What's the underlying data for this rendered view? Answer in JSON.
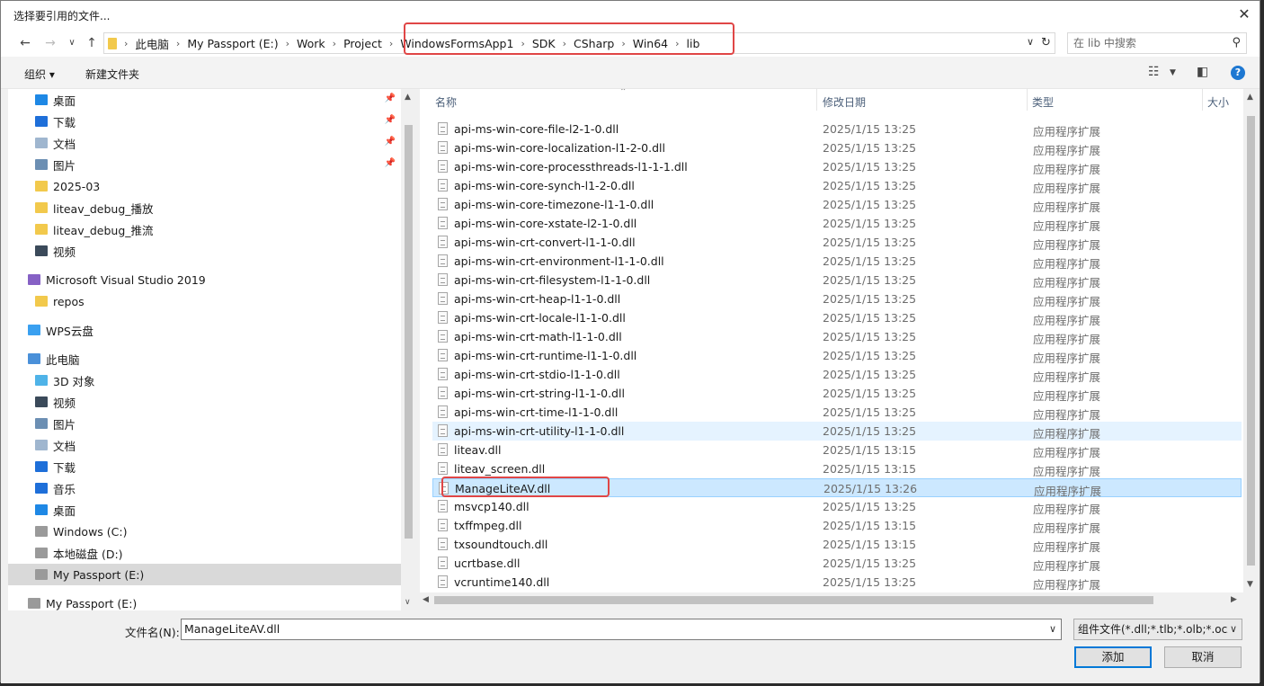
{
  "window": {
    "title": "选择要引用的文件..."
  },
  "address": {
    "crumbs": [
      "此电脑",
      "My Passport (E:)",
      "Work",
      "Project",
      "WindowsFormsApp1",
      "SDK",
      "CSharp",
      "Win64",
      "lib"
    ],
    "search_placeholder": "在 lib 中搜索"
  },
  "toolbar": {
    "organize": "组织 ▾",
    "new_folder": "新建文件夹"
  },
  "nav": {
    "items": [
      {
        "label": "桌面",
        "icon": "desktop-icon",
        "color": "#1e88e5",
        "pinned": true
      },
      {
        "label": "下载",
        "icon": "download-icon",
        "color": "#1e6fd9",
        "pinned": true
      },
      {
        "label": "文档",
        "icon": "documents-icon",
        "color": "#9fb6cf",
        "pinned": true
      },
      {
        "label": "图片",
        "icon": "pictures-icon",
        "color": "#6c8fb3",
        "pinned": true
      },
      {
        "label": "2025-03",
        "icon": "folder-icon",
        "color": "#f2c94c"
      },
      {
        "label": "liteav_debug_播放",
        "icon": "folder-icon",
        "color": "#f2c94c"
      },
      {
        "label": "liteav_debug_推流",
        "icon": "folder-icon",
        "color": "#f2c94c"
      },
      {
        "label": "视频",
        "icon": "videos-icon",
        "color": "#3b4a5a"
      },
      {
        "label": "Microsoft Visual Studio 2019",
        "icon": "visual-studio-icon",
        "color": "#8661c5"
      },
      {
        "label": "repos",
        "icon": "folder-icon",
        "color": "#f2c94c"
      },
      {
        "label": "WPS云盘",
        "icon": "cloud-icon",
        "color": "#3aa0f0"
      },
      {
        "label": "此电脑",
        "icon": "computer-icon",
        "color": "#4a90d9"
      },
      {
        "label": "3D 对象",
        "icon": "3d-objects-icon",
        "color": "#4fb3e8"
      },
      {
        "label": "视频",
        "icon": "videos-icon",
        "color": "#3b4a5a"
      },
      {
        "label": "图片",
        "icon": "pictures-icon",
        "color": "#6c8fb3"
      },
      {
        "label": "文档",
        "icon": "documents-icon",
        "color": "#9fb6cf"
      },
      {
        "label": "下载",
        "icon": "download-icon",
        "color": "#1e6fd9"
      },
      {
        "label": "音乐",
        "icon": "music-icon",
        "color": "#1e6fd9"
      },
      {
        "label": "桌面",
        "icon": "desktop-icon",
        "color": "#1e88e5"
      },
      {
        "label": "Windows (C:)",
        "icon": "drive-icon",
        "color": "#9a9a9a"
      },
      {
        "label": "本地磁盘 (D:)",
        "icon": "drive-icon",
        "color": "#9a9a9a"
      },
      {
        "label": "My Passport (E:)",
        "icon": "drive-icon",
        "color": "#9a9a9a",
        "selected": true
      },
      {
        "label": "My Passport (E:)",
        "icon": "drive-icon",
        "color": "#9a9a9a"
      }
    ]
  },
  "list": {
    "columns": {
      "name": "名称",
      "modified": "修改日期",
      "type": "类型",
      "size": "大小"
    },
    "rows": [
      {
        "name": "api-ms-win-core-file-l2-1-0.dll",
        "date": "2025/1/15 13:25",
        "type": "应用程序扩展"
      },
      {
        "name": "api-ms-win-core-localization-l1-2-0.dll",
        "date": "2025/1/15 13:25",
        "type": "应用程序扩展"
      },
      {
        "name": "api-ms-win-core-processthreads-l1-1-1.dll",
        "date": "2025/1/15 13:25",
        "type": "应用程序扩展"
      },
      {
        "name": "api-ms-win-core-synch-l1-2-0.dll",
        "date": "2025/1/15 13:25",
        "type": "应用程序扩展"
      },
      {
        "name": "api-ms-win-core-timezone-l1-1-0.dll",
        "date": "2025/1/15 13:25",
        "type": "应用程序扩展"
      },
      {
        "name": "api-ms-win-core-xstate-l2-1-0.dll",
        "date": "2025/1/15 13:25",
        "type": "应用程序扩展"
      },
      {
        "name": "api-ms-win-crt-convert-l1-1-0.dll",
        "date": "2025/1/15 13:25",
        "type": "应用程序扩展"
      },
      {
        "name": "api-ms-win-crt-environment-l1-1-0.dll",
        "date": "2025/1/15 13:25",
        "type": "应用程序扩展"
      },
      {
        "name": "api-ms-win-crt-filesystem-l1-1-0.dll",
        "date": "2025/1/15 13:25",
        "type": "应用程序扩展"
      },
      {
        "name": "api-ms-win-crt-heap-l1-1-0.dll",
        "date": "2025/1/15 13:25",
        "type": "应用程序扩展"
      },
      {
        "name": "api-ms-win-crt-locale-l1-1-0.dll",
        "date": "2025/1/15 13:25",
        "type": "应用程序扩展"
      },
      {
        "name": "api-ms-win-crt-math-l1-1-0.dll",
        "date": "2025/1/15 13:25",
        "type": "应用程序扩展"
      },
      {
        "name": "api-ms-win-crt-runtime-l1-1-0.dll",
        "date": "2025/1/15 13:25",
        "type": "应用程序扩展"
      },
      {
        "name": "api-ms-win-crt-stdio-l1-1-0.dll",
        "date": "2025/1/15 13:25",
        "type": "应用程序扩展"
      },
      {
        "name": "api-ms-win-crt-string-l1-1-0.dll",
        "date": "2025/1/15 13:25",
        "type": "应用程序扩展"
      },
      {
        "name": "api-ms-win-crt-time-l1-1-0.dll",
        "date": "2025/1/15 13:25",
        "type": "应用程序扩展"
      },
      {
        "name": "api-ms-win-crt-utility-l1-1-0.dll",
        "date": "2025/1/15 13:25",
        "type": "应用程序扩展",
        "state": "hover"
      },
      {
        "name": "liteav.dll",
        "date": "2025/1/15 13:15",
        "type": "应用程序扩展"
      },
      {
        "name": "liteav_screen.dll",
        "date": "2025/1/15 13:15",
        "type": "应用程序扩展"
      },
      {
        "name": "ManageLiteAV.dll",
        "date": "2025/1/15 13:26",
        "type": "应用程序扩展",
        "state": "selected"
      },
      {
        "name": "msvcp140.dll",
        "date": "2025/1/15 13:25",
        "type": "应用程序扩展"
      },
      {
        "name": "txffmpeg.dll",
        "date": "2025/1/15 13:15",
        "type": "应用程序扩展"
      },
      {
        "name": "txsoundtouch.dll",
        "date": "2025/1/15 13:15",
        "type": "应用程序扩展"
      },
      {
        "name": "ucrtbase.dll",
        "date": "2025/1/15 13:25",
        "type": "应用程序扩展"
      },
      {
        "name": "vcruntime140.dll",
        "date": "2025/1/15 13:25",
        "type": "应用程序扩展"
      }
    ]
  },
  "footer": {
    "filename_label": "文件名(N):",
    "filename_value": "ManageLiteAV.dll",
    "filter": "组件文件(*.dll;*.tlb;*.olb;*.ocx;",
    "add_button": "添加",
    "cancel_button": "取消"
  },
  "colors": {
    "accent": "#0078d7",
    "highlight_box": "#e04646",
    "selection": "#cce8ff"
  }
}
